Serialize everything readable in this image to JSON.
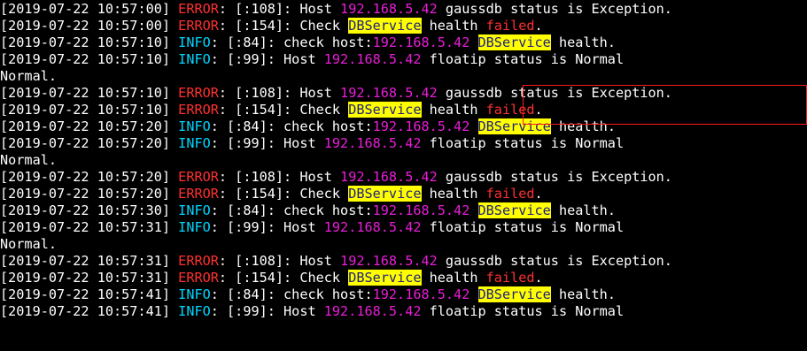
{
  "terminal": {
    "lines": [
      {
        "segments": [
          {
            "text": "[2019-07-22 10:57:00] ",
            "style": "normal"
          },
          {
            "text": "ERROR",
            "style": "error"
          },
          {
            "text": ": [:108]: Host ",
            "style": "normal"
          },
          {
            "text": "192.168.5.42",
            "style": "ip"
          },
          {
            "text": " gaussdb status is Exception.",
            "style": "normal"
          }
        ]
      },
      {
        "segments": [
          {
            "text": "[2019-07-22 10:57:00] ",
            "style": "normal"
          },
          {
            "text": "ERROR",
            "style": "error"
          },
          {
            "text": ": [:154]: Check ",
            "style": "normal"
          },
          {
            "text": "DBService",
            "style": "hl"
          },
          {
            "text": " health ",
            "style": "normal"
          },
          {
            "text": "failed",
            "style": "failed"
          },
          {
            "text": ".",
            "style": "normal"
          }
        ]
      },
      {
        "segments": [
          {
            "text": "[2019-07-22 10:57:10] ",
            "style": "normal"
          },
          {
            "text": "INFO",
            "style": "info"
          },
          {
            "text": ": [:84]: check host:",
            "style": "normal"
          },
          {
            "text": "192.168.5.42",
            "style": "ip"
          },
          {
            "text": " ",
            "style": "normal"
          },
          {
            "text": "DBService",
            "style": "hl"
          },
          {
            "text": " health.",
            "style": "normal"
          }
        ]
      },
      {
        "segments": [
          {
            "text": "[2019-07-22 10:57:10] ",
            "style": "normal"
          },
          {
            "text": "INFO",
            "style": "info"
          },
          {
            "text": ": [:99]: Host ",
            "style": "normal"
          },
          {
            "text": "192.168.5.42",
            "style": "ip"
          },
          {
            "text": " floatip status is Normal",
            "style": "normal"
          }
        ]
      },
      {
        "segments": [
          {
            "text": "Normal.",
            "style": "normal"
          }
        ]
      },
      {
        "segments": [
          {
            "text": "[2019-07-22 10:57:10] ",
            "style": "normal"
          },
          {
            "text": "ERROR",
            "style": "error"
          },
          {
            "text": ": [:108]: Host ",
            "style": "normal"
          },
          {
            "text": "192.168.5.42",
            "style": "ip"
          },
          {
            "text": " gaussdb status is Exception.",
            "style": "normal"
          }
        ]
      },
      {
        "segments": [
          {
            "text": "[2019-07-22 10:57:10] ",
            "style": "normal"
          },
          {
            "text": "ERROR",
            "style": "error"
          },
          {
            "text": ": [:154]: Check ",
            "style": "normal"
          },
          {
            "text": "DBService",
            "style": "hl"
          },
          {
            "text": " health ",
            "style": "normal"
          },
          {
            "text": "failed",
            "style": "failed"
          },
          {
            "text": ".",
            "style": "normal"
          }
        ]
      },
      {
        "segments": [
          {
            "text": "[2019-07-22 10:57:20] ",
            "style": "normal"
          },
          {
            "text": "INFO",
            "style": "info"
          },
          {
            "text": ": [:84]: check host:",
            "style": "normal"
          },
          {
            "text": "192.168.5.42",
            "style": "ip"
          },
          {
            "text": " ",
            "style": "normal"
          },
          {
            "text": "DBService",
            "style": "hl"
          },
          {
            "text": " health.",
            "style": "normal"
          }
        ]
      },
      {
        "segments": [
          {
            "text": "[2019-07-22 10:57:20] ",
            "style": "normal"
          },
          {
            "text": "INFO",
            "style": "info"
          },
          {
            "text": ": [:99]: Host ",
            "style": "normal"
          },
          {
            "text": "192.168.5.42",
            "style": "ip"
          },
          {
            "text": " floatip status is Normal",
            "style": "normal"
          }
        ]
      },
      {
        "segments": [
          {
            "text": "Normal.",
            "style": "normal"
          }
        ]
      },
      {
        "segments": [
          {
            "text": "[2019-07-22 10:57:20] ",
            "style": "normal"
          },
          {
            "text": "ERROR",
            "style": "error"
          },
          {
            "text": ": [:108]: Host ",
            "style": "normal"
          },
          {
            "text": "192.168.5.42",
            "style": "ip"
          },
          {
            "text": " gaussdb status is Exception.",
            "style": "normal"
          }
        ]
      },
      {
        "segments": [
          {
            "text": "[2019-07-22 10:57:20] ",
            "style": "normal"
          },
          {
            "text": "ERROR",
            "style": "error"
          },
          {
            "text": ": [:154]: Check ",
            "style": "normal"
          },
          {
            "text": "DBService",
            "style": "hl"
          },
          {
            "text": " health ",
            "style": "normal"
          },
          {
            "text": "failed",
            "style": "failed"
          },
          {
            "text": ".",
            "style": "normal"
          }
        ]
      },
      {
        "segments": [
          {
            "text": "[2019-07-22 10:57:30] ",
            "style": "normal"
          },
          {
            "text": "INFO",
            "style": "info"
          },
          {
            "text": ": [:84]: check host:",
            "style": "normal"
          },
          {
            "text": "192.168.5.42",
            "style": "ip"
          },
          {
            "text": " ",
            "style": "normal"
          },
          {
            "text": "DBService",
            "style": "hl"
          },
          {
            "text": " health.",
            "style": "normal"
          }
        ]
      },
      {
        "segments": [
          {
            "text": "[2019-07-22 10:57:31] ",
            "style": "normal"
          },
          {
            "text": "INFO",
            "style": "info"
          },
          {
            "text": ": [:99]: Host ",
            "style": "normal"
          },
          {
            "text": "192.168.5.42",
            "style": "ip"
          },
          {
            "text": " floatip status is Normal",
            "style": "normal"
          }
        ]
      },
      {
        "segments": [
          {
            "text": "Normal.",
            "style": "normal"
          }
        ]
      },
      {
        "segments": [
          {
            "text": "[2019-07-22 10:57:31] ",
            "style": "normal"
          },
          {
            "text": "ERROR",
            "style": "error"
          },
          {
            "text": ": [:108]: Host ",
            "style": "normal"
          },
          {
            "text": "192.168.5.42",
            "style": "ip"
          },
          {
            "text": " gaussdb status is Exception.",
            "style": "normal"
          }
        ]
      },
      {
        "segments": [
          {
            "text": "[2019-07-22 10:57:31] ",
            "style": "normal"
          },
          {
            "text": "ERROR",
            "style": "error"
          },
          {
            "text": ": [:154]: Check ",
            "style": "normal"
          },
          {
            "text": "DBService",
            "style": "hl"
          },
          {
            "text": " health ",
            "style": "normal"
          },
          {
            "text": "failed",
            "style": "failed"
          },
          {
            "text": ".",
            "style": "normal"
          }
        ]
      },
      {
        "segments": [
          {
            "text": "[2019-07-22 10:57:41] ",
            "style": "normal"
          },
          {
            "text": "INFO",
            "style": "info"
          },
          {
            "text": ": [:84]: check host:",
            "style": "normal"
          },
          {
            "text": "192.168.5.42",
            "style": "ip"
          },
          {
            "text": " ",
            "style": "normal"
          },
          {
            "text": "DBService",
            "style": "hl"
          },
          {
            "text": " health.",
            "style": "normal"
          }
        ]
      },
      {
        "segments": [
          {
            "text": "[2019-07-22 10:57:41] ",
            "style": "normal"
          },
          {
            "text": "INFO",
            "style": "info"
          },
          {
            "text": ": [:99]: Host ",
            "style": "normal"
          },
          {
            "text": "192.168.5.42",
            "style": "ip"
          },
          {
            "text": " floatip status is Normal",
            "style": "normal"
          }
        ]
      }
    ]
  },
  "colors": {
    "background": "#000000",
    "text": "#ffffff",
    "error": "#ff3030",
    "info": "#00d7ff",
    "ip": "#e81ed8",
    "highlight_bg": "#ffff00",
    "highlight_fg": "#202080",
    "annotation_box": "#ff1a1a"
  }
}
